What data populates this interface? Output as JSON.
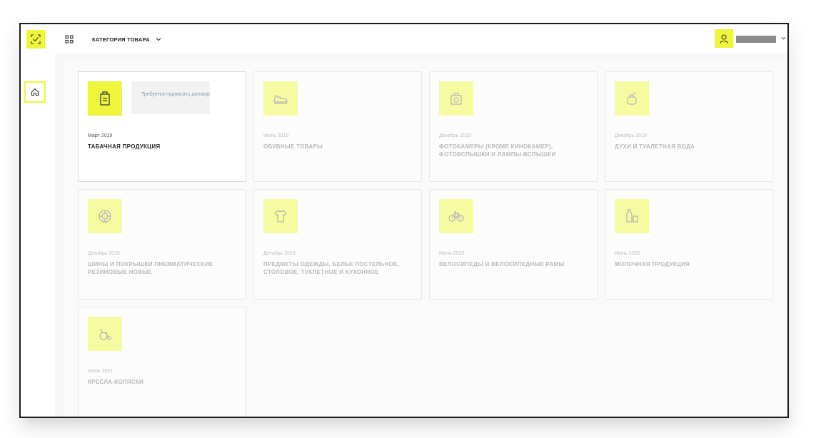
{
  "header": {
    "category_label": "КАТЕГОРИЯ ТОВАРА",
    "logo_icon": "checkmark-logo-icon",
    "grid_icon": "grid-icon",
    "user_icon": "user-icon",
    "dropdown_icon": "chevron-down-icon"
  },
  "sidebar": {
    "home_icon": "home-icon"
  },
  "colors": {
    "accent": "#eef53a",
    "accent_light": "#f6fba2",
    "border": "#1c1c1c"
  },
  "cards": [
    {
      "date": "Март 2019",
      "title": "ТАБАЧНАЯ ПРОДУКЦИЯ",
      "icon": "cigarette-pack-icon",
      "notice": "Требуется подписать договор"
    },
    {
      "date": "Июль 2019",
      "title": "ОБУВНЫЕ ТОВАРЫ",
      "icon": "shoe-icon"
    },
    {
      "date": "Декабрь 2019",
      "title": "ФОТОКАМЕРЫ (КРОМЕ КИНОКАМЕР), ФОТОВСПЫШКИ И ЛАМПЫ-ВСПЫШКИ",
      "icon": "camera-icon"
    },
    {
      "date": "Декабрь 2019",
      "title": "ДУХИ И ТУАЛЕТНАЯ ВОДА",
      "icon": "perfume-icon"
    },
    {
      "date": "Декабрь 2019",
      "title": "ШИНЫ И ПОКРЫШКИ ПНЕВМАТИЧЕСКИЕ РЕЗИНОВЫЕ НОВЫЕ",
      "icon": "tire-icon"
    },
    {
      "date": "Декабрь 2019",
      "title": "ПРЕДМЕТЫ ОДЕЖДЫ, БЕЛЬЕ ПОСТЕЛЬНОЕ, СТОЛОВОЕ, ТУАЛЕТНОЕ И КУХОННОЕ",
      "icon": "shirt-icon"
    },
    {
      "date": "Июнь 2020",
      "title": "ВЕЛОСИПЕДЫ И ВЕЛОСИПЕДНЫЕ РАМЫ",
      "icon": "bicycle-icon"
    },
    {
      "date": "Июнь 2020",
      "title": "МОЛОЧНАЯ ПРОДУКЦИЯ",
      "icon": "milk-icon"
    },
    {
      "date": "Июнь 2021",
      "title": "КРЕСЛА-КОЛЯСКИ",
      "icon": "wheelchair-icon"
    }
  ]
}
